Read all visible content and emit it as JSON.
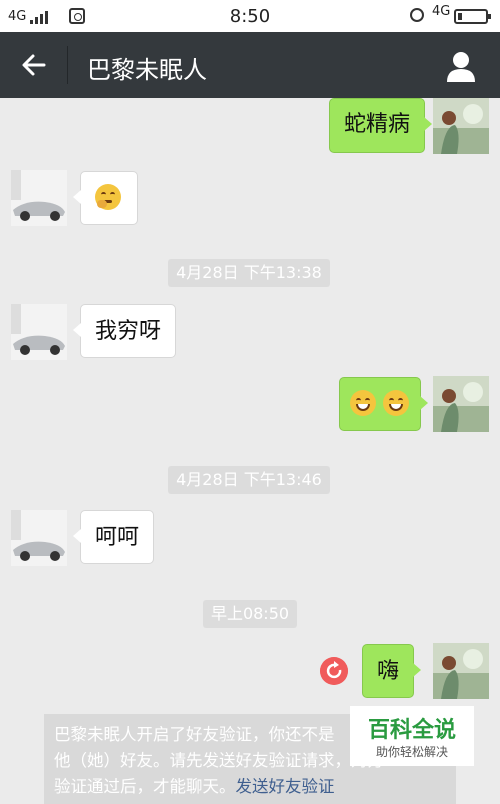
{
  "status_bar": {
    "network_left": "4G",
    "time": "8:50",
    "network_right": "4G"
  },
  "header": {
    "title": "巴黎未眠人",
    "back_icon": "back-arrow-icon",
    "profile_icon": "person-icon"
  },
  "messages": [
    {
      "side": "right",
      "text": "蛇精病"
    },
    {
      "side": "left",
      "emoji": "thinking-face-emoji"
    },
    {
      "type": "timestamp",
      "text": "4月28日 下午13:38"
    },
    {
      "side": "left",
      "text": "我穷呀"
    },
    {
      "side": "right",
      "emoji": [
        "grinning-face-emoji",
        "grinning-face-emoji"
      ]
    },
    {
      "type": "timestamp",
      "text": "4月28日 下午13:46"
    },
    {
      "side": "left",
      "text": "呵呵"
    },
    {
      "type": "timestamp",
      "text": "早上08:50"
    },
    {
      "side": "right",
      "text": "嗨",
      "status_icon": "resend-icon"
    }
  ],
  "system_notice": {
    "line1": "巴黎未眠人开启了好友验证，你还不是",
    "line2": "他（她）好友。请先发送好友验证请求，对方",
    "line3_prefix": "验证通过后，才能聊天。",
    "link": "发送好友验证"
  },
  "watermark": {
    "title": "百科全说",
    "subtitle": "助你轻松解决"
  },
  "colors": {
    "header_bg": "#34393d",
    "chat_bg": "#ebebeb",
    "sent_bubble": "#9ee65c",
    "received_bubble": "#ffffff"
  }
}
